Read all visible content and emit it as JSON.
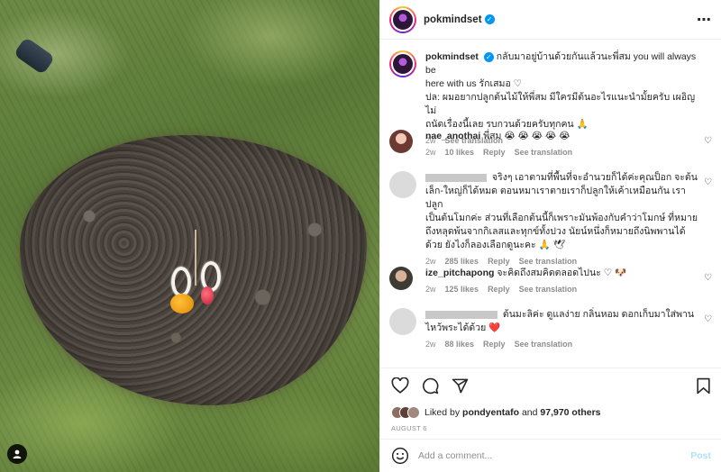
{
  "post": {
    "username": "pokmindset",
    "verified_mark": "✓",
    "more_icon": "⋯"
  },
  "caption": {
    "username": "pokmindset",
    "text_line1": "กลับมาอยู่บ้านด้วยกันแล้วนะพี่สม you will always be",
    "text_line2": "here with us รักเสมอ ♡",
    "text_line3": "ปล: ผมอยากปลูกต้นไม้ให้พี่สม มีใครมีต้นอะไรแนะนำมั้ยครับ เผอิญไม่",
    "text_line4": "ถนัดเรื่องนี้เลย รบกวนด้วยครับทุกคน 🙏",
    "time": "2w",
    "see_translation": "See translation"
  },
  "comments": [
    {
      "username": "nae_anothai",
      "text": "พี่สม 😭 😭 😭 😭 😭",
      "time": "2w",
      "likes": "10 likes",
      "reply": "Reply",
      "see_translation": "See translation"
    },
    {
      "username": "",
      "text_line1": "จริงๆ เอาตามที่พื้นที่จะอำนวยก็ได้ค่ะคุณป็อก จะต้น",
      "text_line2": "เล็ก-ใหญ่ก็ได้หมด ตอนหมาเราตายเราก็ปลูกให้เค้าเหมือนกัน เราปลูก",
      "text_line3": "เป็นต้นโมกค่ะ ส่วนที่เลือกต้นนี้ก็เพราะมันพ้องกับคำว่าโมกษ์ ที่หมาย",
      "text_line4": "ถึงหลุดพ้นจากกิเลสและทุกข์ทั้งปวง นัยน์หนึ่งก็หมายถึงนิพพานได้",
      "text_line5": "ด้วย ยังไงก็ลองเลือกดูนะคะ 🙏 🕊",
      "time": "2w",
      "likes": "285 likes",
      "reply": "Reply",
      "see_translation": "See translation"
    },
    {
      "username": "ize_pitchapong",
      "text": "จะคิดถึงสมคิดตลอดไปนะ ♡ 🐶",
      "time": "2w",
      "likes": "125 likes",
      "reply": "Reply",
      "see_translation": "See translation"
    },
    {
      "username": "",
      "text_line1": "ต้นมะลิค่ะ ดูแลง่าย กลิ่นหอม ดอกเก็บมาใส่พาน",
      "text_line2": "ไหว้พระได้ด้วย ❤️",
      "time": "2w",
      "likes": "88 likes",
      "reply": "Reply",
      "see_translation": "See translation"
    }
  ],
  "actions": {
    "like_icon": "heart-icon",
    "comment_icon": "comment-icon",
    "share_icon": "share-icon",
    "save_icon": "bookmark-icon"
  },
  "likes": {
    "prefix": "Liked by ",
    "user": "pondyentafo",
    "middle": " and ",
    "count": "97,970 others"
  },
  "date": "AUGUST 6",
  "add_comment": {
    "placeholder": "Add a comment...",
    "post_label": "Post"
  },
  "colors": {
    "verified": "#0095f6",
    "muted": "#8e8e8e",
    "post_disabled": "#b2dffc"
  }
}
